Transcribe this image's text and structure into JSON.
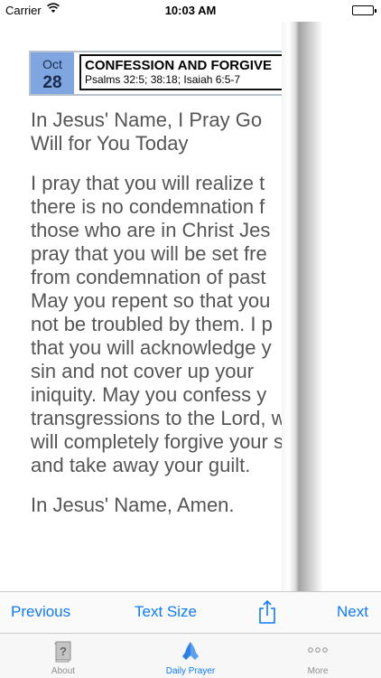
{
  "status_bar": {
    "carrier": "Carrier",
    "time": "10:03 AM"
  },
  "reading": {
    "month": "Oct",
    "day": "28",
    "title": "CONFESSION AND FORGIVE",
    "references": "Psalms 32:5; 38:18; Isaiah 6:5-7"
  },
  "prayer": {
    "heading_lines": [
      "In Jesus' Name, I Pray Go",
      "Will for You Today"
    ],
    "body_lines": [
      "I pray that you will realize t",
      "there is no condemnation f",
      "those who are in Christ Jes",
      "pray that you will be set fre",
      "from condemnation of past",
      "May you repent so that you",
      "not be troubled by them. I p",
      "that you will acknowledge y",
      "sin and not cover up your",
      "iniquity. May you confess y",
      "transgressions to the Lord, w",
      "will completely forgive your s",
      "and take away your guilt."
    ],
    "closing": "In Jesus' Name, Amen."
  },
  "toolbar": {
    "previous_label": "Previous",
    "text_size_label": "Text Size",
    "share_icon": "share-icon",
    "next_label": "Next",
    "accent_color": "#0e7afe"
  },
  "tabbar": {
    "tabs": [
      {
        "label": "About",
        "icon": "book-question-icon",
        "active": false
      },
      {
        "label": "Daily Prayer",
        "icon": "praying-hands-icon",
        "active": true
      },
      {
        "label": "More",
        "icon": "more-dots-icon",
        "active": false
      }
    ],
    "inactive_color": "#8e8e93"
  }
}
